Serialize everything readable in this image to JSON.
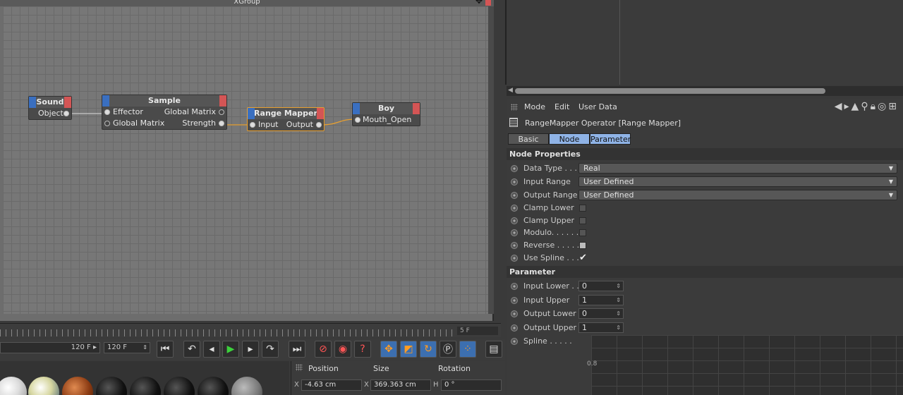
{
  "xpresso": {
    "title": "XGroup",
    "nodes": {
      "sound": {
        "title": "Sound",
        "ports": [
          "Object"
        ]
      },
      "sample": {
        "title": "Sample",
        "in_ports": [
          "Effector",
          "Global Matrix"
        ],
        "out_ports": [
          "Global Matrix",
          "Strength"
        ]
      },
      "range_mapper": {
        "title": "Range Mapper",
        "in_port": "Input",
        "out_port": "Output"
      },
      "boy": {
        "title": "Boy",
        "in_port": "Mouth_Open"
      }
    }
  },
  "timeline": {
    "ruler_end": "5 F",
    "end_frame_field": "120 F",
    "end_frame_field2": "120 F"
  },
  "coordinates": {
    "headers": [
      "Position",
      "Size",
      "Rotation"
    ],
    "axes": [
      "X",
      "X",
      "H"
    ],
    "values": [
      "-4.63 cm",
      "369.363 cm",
      "0 °"
    ]
  },
  "attributes": {
    "menu": [
      "Mode",
      "Edit",
      "User Data"
    ],
    "object_title": "RangeMapper Operator [Range Mapper]",
    "tabs": [
      "Basic",
      "Node",
      "Parameter"
    ],
    "sections": {
      "node_properties": "Node Properties",
      "parameter": "Parameter"
    },
    "node_properties": [
      {
        "label": "Data Type . . . .",
        "type": "dropdown",
        "value": "Real"
      },
      {
        "label": "Input Range",
        "type": "dropdown",
        "value": "User Defined"
      },
      {
        "label": "Output Range",
        "type": "dropdown",
        "value": "User Defined"
      },
      {
        "label": "Clamp Lower",
        "type": "checkbox",
        "checked": false
      },
      {
        "label": "Clamp Upper",
        "type": "checkbox",
        "checked": false
      },
      {
        "label": "Modulo. . . . . .",
        "type": "checkbox",
        "checked": false
      },
      {
        "label": "Reverse . . . . . .",
        "type": "checkbox",
        "checked": false
      },
      {
        "label": "Use Spline . . .",
        "type": "checkbox",
        "checked": true
      }
    ],
    "parameters": [
      {
        "label": "Input Lower . .",
        "value": "0"
      },
      {
        "label": "Input Upper",
        "value": "1"
      },
      {
        "label": "Output Lower",
        "value": "0"
      },
      {
        "label": "Output Upper",
        "value": "1"
      }
    ],
    "spline_label": "Spline . . . . .",
    "spline_y_tick": "0.8"
  }
}
